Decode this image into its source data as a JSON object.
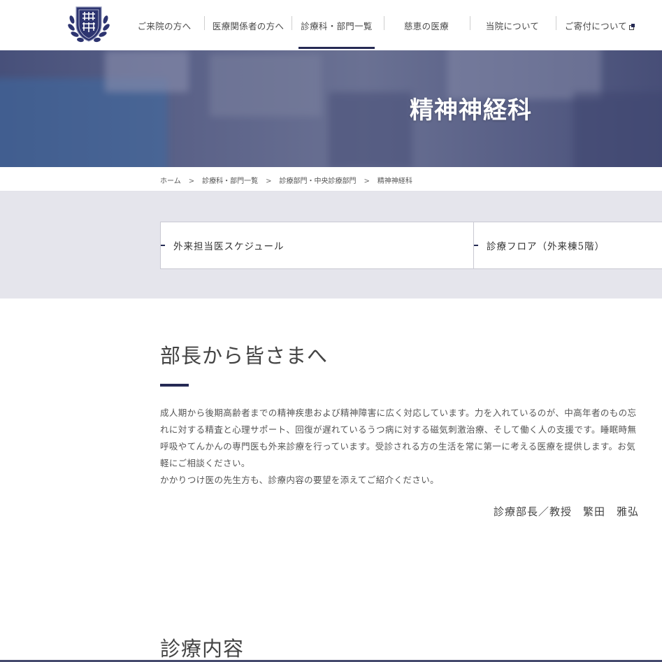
{
  "header": {
    "nav": [
      {
        "label": "ご来院の方へ",
        "active": false,
        "external": false
      },
      {
        "label": "医療関係者の方へ",
        "active": false,
        "external": false
      },
      {
        "label": "診療科・部門一覧",
        "active": true,
        "external": false
      },
      {
        "label": "慈恵の医療",
        "active": false,
        "external": false
      },
      {
        "label": "当院について",
        "active": false,
        "external": false
      },
      {
        "label": "ご寄付について",
        "active": false,
        "external": true
      }
    ]
  },
  "hero": {
    "title": "精神神経科"
  },
  "breadcrumb": {
    "items": [
      "ホーム",
      "診療科・部門一覧",
      "診療部門・中央診療部門",
      "精神神経科"
    ],
    "separator": ">"
  },
  "quick_links": [
    {
      "label": "外来担当医スケジュール"
    },
    {
      "label": "診療フロア（外来棟5階）"
    }
  ],
  "greeting": {
    "heading": "部長から皆さまへ",
    "paragraphs": [
      "成人期から後期高齢者までの精神疾患および精神障害に広く対応しています。力を入れているのが、中高年者のもの忘れに対する精査と心理サポート、回復が遅れているうつ病に対する磁気刺激治療、そして働く人の支援です。睡眠時無呼吸やてんかんの専門医も外来診療を行っています。受診される方の生活を常に第一に考える医療を提供します。お気軽にご相談ください。",
      "かかりつけ医の先生方も、診療内容の要望を添えてご紹介ください。"
    ],
    "signature": "診療部長／教授　繁田　雅弘"
  },
  "next_section": {
    "heading": "診療内容"
  },
  "colors": {
    "accent": "#252a54",
    "band": "#e5e5ec",
    "hero": "#5c6389"
  },
  "icons": {
    "logo": "university-emblem-logo",
    "external": "external-link-icon"
  }
}
